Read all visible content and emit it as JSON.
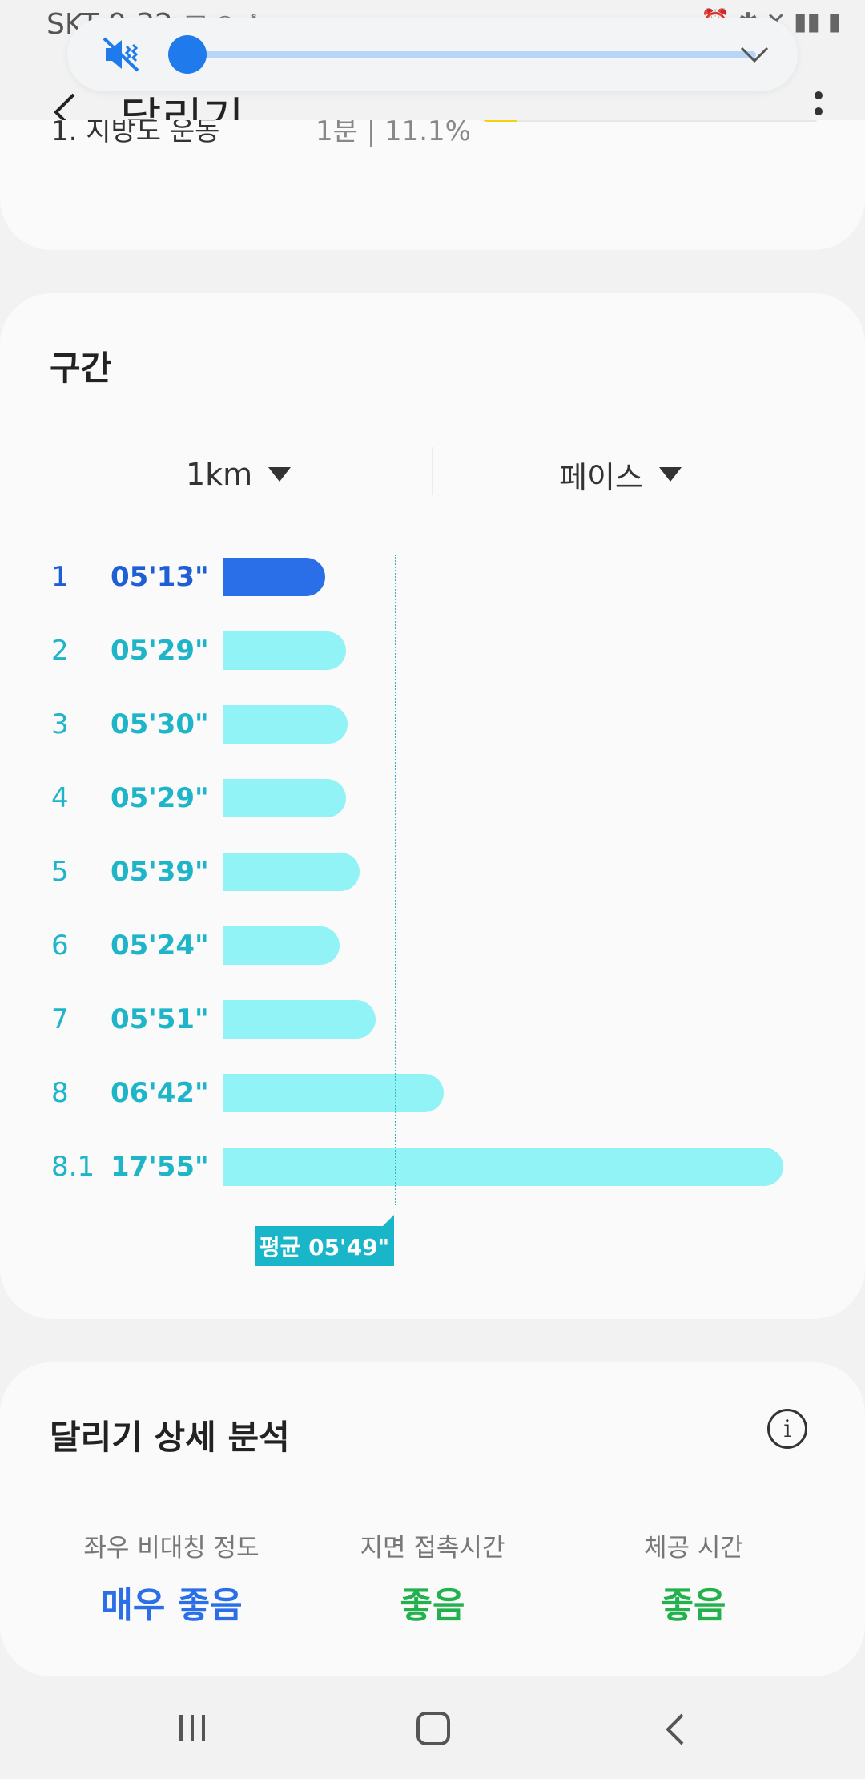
{
  "status_bar": {
    "carrier_time": "SKT 9:32"
  },
  "volume": {
    "level": 0.0,
    "accent_color": "#1f7aec"
  },
  "app_bar": {
    "title": "달리기"
  },
  "top_card": {
    "row_label": "1. 지방도 운동",
    "row_value": "1분 | 11.1%"
  },
  "segments": {
    "title": "구간",
    "distance_unit": "1km",
    "metric": "페이스",
    "average_label": "평균 05'49\"",
    "rows": [
      {
        "index": "1",
        "pace": "05'13\"",
        "seconds": 313,
        "active": true
      },
      {
        "index": "2",
        "pace": "05'29\"",
        "seconds": 329
      },
      {
        "index": "3",
        "pace": "05'30\"",
        "seconds": 330
      },
      {
        "index": "4",
        "pace": "05'29\"",
        "seconds": 329
      },
      {
        "index": "5",
        "pace": "05'39\"",
        "seconds": 339
      },
      {
        "index": "6",
        "pace": "05'24\"",
        "seconds": 324
      },
      {
        "index": "7",
        "pace": "05'51\"",
        "seconds": 351
      },
      {
        "index": "8",
        "pace": "06'42\"",
        "seconds": 402
      },
      {
        "index": "8.1",
        "pace": "17'55\"",
        "seconds": 1075
      }
    ],
    "average_seconds": 349
  },
  "analysis": {
    "title": "달리기 상세 분석",
    "metrics": [
      {
        "label": "좌우 비대칭 정도",
        "value": "매우 좋음"
      },
      {
        "label": "지면 접촉시간",
        "value": "좋음"
      },
      {
        "label": "체공 시간",
        "value": "좋음"
      }
    ]
  },
  "colors": {
    "active_bar": "#2a6ee8",
    "bar": "#92f3f6",
    "teal_text": "#1fb5c8",
    "good": "#22b14c"
  }
}
